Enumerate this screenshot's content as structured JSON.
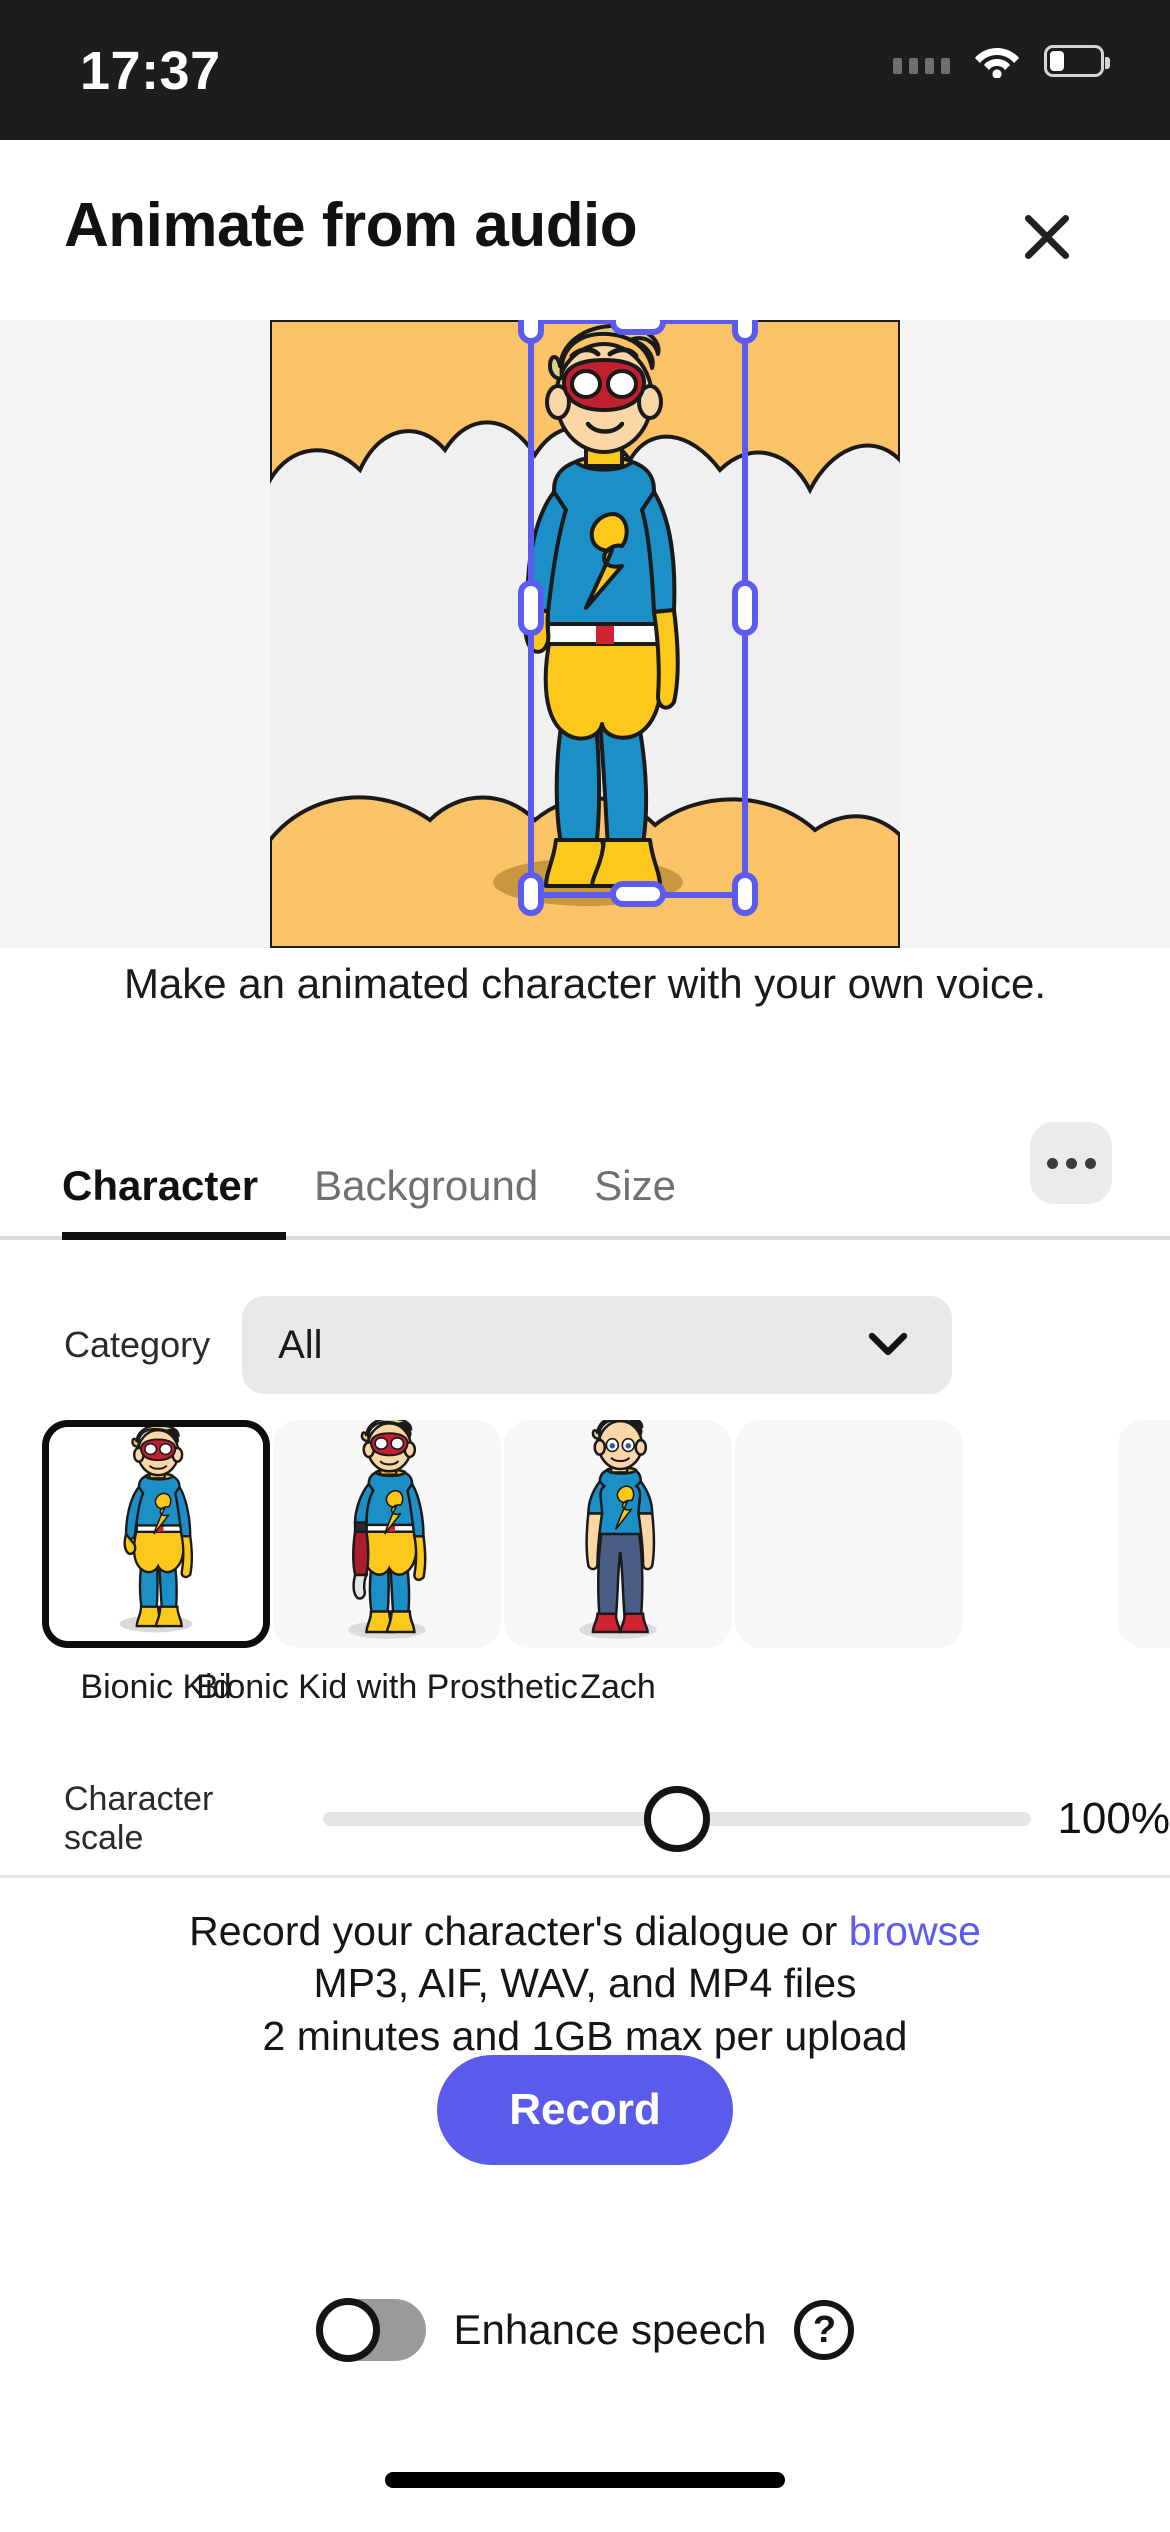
{
  "status_bar": {
    "time": "17:37",
    "icons": [
      "signal-dots-icon",
      "wifi-icon",
      "battery-icon"
    ],
    "battery_level_pct": 30
  },
  "header": {
    "title": "Animate from audio",
    "close_icon": "close-icon"
  },
  "preview": {
    "selection_label": "character-selection-frame",
    "selection_color": "#5b5bf0",
    "scene_background_color": "#f0f0f0",
    "scene_accent_color": "#fac367",
    "canvas_surround_color": "#f5f5f5"
  },
  "subtitle": "Make an animated character with your own voice.",
  "tabs": [
    {
      "label": "Character",
      "active": true
    },
    {
      "label": "Background",
      "active": false
    },
    {
      "label": "Size",
      "active": false
    }
  ],
  "more_button": {
    "icon": "more-horizontal-icon"
  },
  "category": {
    "label": "Category",
    "value": "All",
    "chevron_icon": "chevron-down-icon"
  },
  "characters": [
    {
      "label": "Bionic Kid",
      "selected": true
    },
    {
      "label": "Bionic Kid with Prosthetic",
      "selected": false
    },
    {
      "label": "Zach",
      "selected": false
    },
    {
      "label": "",
      "selected": false
    }
  ],
  "character_scale": {
    "label": "Character scale",
    "value": "100%",
    "thumb_position_pct": 50
  },
  "record": {
    "line1_prefix": "Record your character's dialogue or ",
    "browse_link": "browse",
    "line2": "MP3, AIF, WAV, and MP4 files",
    "line3": "2 minutes and 1GB max per upload",
    "button_label": "Record",
    "button_color": "#5b5beb"
  },
  "enhance_speech": {
    "label": "Enhance speech",
    "enabled": false,
    "help_icon_label": "?"
  }
}
